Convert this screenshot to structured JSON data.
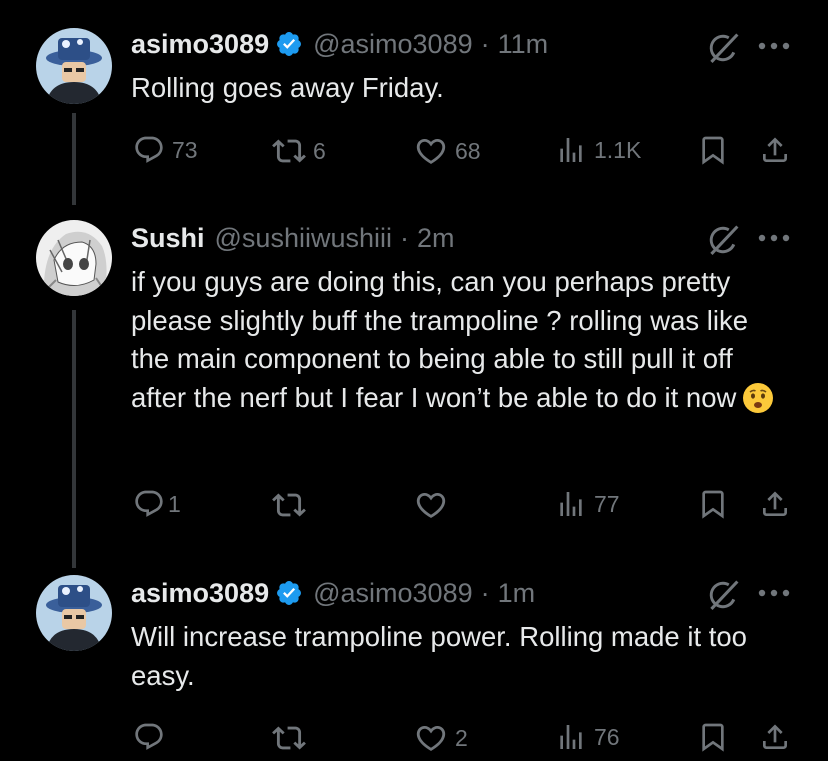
{
  "tweets": [
    {
      "name": "asimo3089",
      "handle": "@asimo3089",
      "sep": "·",
      "time": "11m",
      "verified": true,
      "avatar_icon": "avatar-character-hat",
      "text": "Rolling goes away Friday.",
      "replies": "73",
      "reposts": "6",
      "likes": "68",
      "views": "1.1K"
    },
    {
      "name": "Sushi",
      "handle": "@sushiiwushiii",
      "sep": "·",
      "time": "2m",
      "verified": false,
      "avatar_icon": "avatar-anime-sketch",
      "text": "if you guys are doing this, can you perhaps pretty please slightly buff the trampoline ? rolling was like the main component to being able to still pull it off after the nerf but I fear I won’t be able to do it now",
      "emoji": "worried-face-emoji",
      "replies": "1",
      "reposts": "",
      "likes": "",
      "views": "77"
    },
    {
      "name": "asimo3089",
      "handle": "@asimo3089",
      "sep": "·",
      "time": "1m",
      "verified": true,
      "avatar_icon": "avatar-character-hat",
      "text": "Will increase trampoline power. Rolling made it too easy.",
      "replies": "",
      "reposts": "",
      "likes": "2",
      "views": "76"
    }
  ],
  "colors": {
    "background": "#000000",
    "text": "#e7e9ea",
    "muted": "#71767b",
    "verified": "#1d9bf0",
    "thread_line": "#333639"
  }
}
